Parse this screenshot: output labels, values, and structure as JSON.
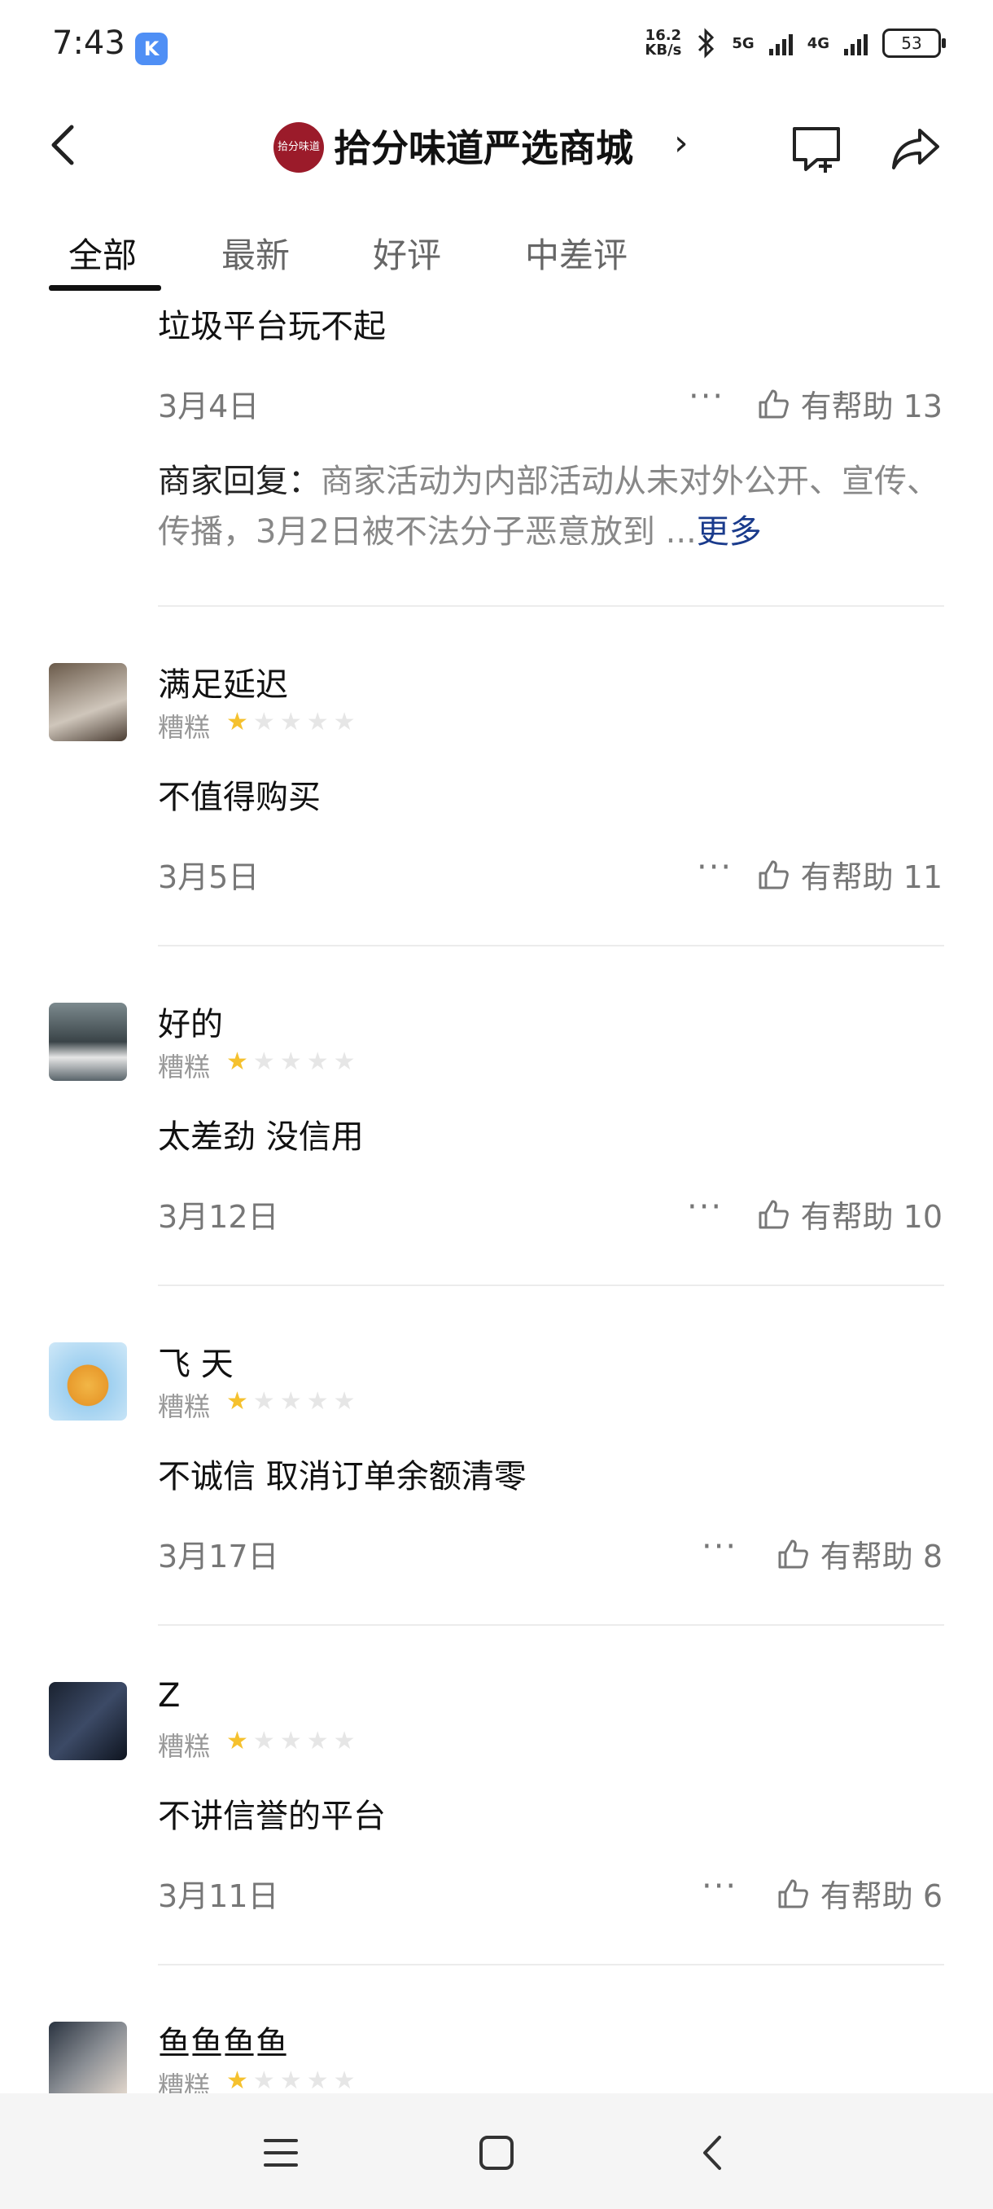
{
  "status_bar": {
    "time": "7:43",
    "app_badge": "K",
    "net_speed_value": "16.2",
    "net_speed_unit": "KB/s",
    "net1": "5G",
    "net2": "4G",
    "battery": "53"
  },
  "header": {
    "logo_text": "拾分味道",
    "shop_name": "拾分味道严选商城",
    "chevron": "›"
  },
  "tabs": [
    {
      "label": "全部",
      "active": true
    },
    {
      "label": "最新",
      "active": false
    },
    {
      "label": "好评",
      "active": false
    },
    {
      "label": "中差评",
      "active": false
    }
  ],
  "partial_review": {
    "comment": "垃圾平台玩不起",
    "date": "3月4日",
    "more": "···",
    "helpful": "有帮助 13",
    "reply_label": "商家回复：",
    "reply_text": "商家活动为内部活动从未对外公开、宣传、传播，3月2日被不法分子恶意放到 ...",
    "reply_more": "更多"
  },
  "reviews": [
    {
      "username": "满足延迟",
      "rating_label": "糟糕",
      "stars": 1,
      "comment": "不值得购买",
      "date": "3月5日",
      "more": "···",
      "helpful": "有帮助 11"
    },
    {
      "username": "好的",
      "rating_label": "糟糕",
      "stars": 1,
      "comment": "太差劲 没信用",
      "date": "3月12日",
      "more": "···",
      "helpful": "有帮助 10"
    },
    {
      "username": "飞 天",
      "rating_label": "糟糕",
      "stars": 1,
      "comment": "不诚信 取消订单余额清零",
      "date": "3月17日",
      "more": "···",
      "helpful": "有帮助 8"
    },
    {
      "username": "Z",
      "rating_label": "糟糕",
      "stars": 1,
      "comment": "不讲信誉的平台",
      "date": "3月11日",
      "more": "···",
      "helpful": "有帮助 6"
    },
    {
      "username": "鱼鱼鱼鱼",
      "rating_label": "糟糕",
      "stars": 1
    }
  ],
  "colors": {
    "accent_star": "#f5c12e",
    "more_link": "#1a3b8c",
    "logo_bg": "#9b1b2a"
  }
}
